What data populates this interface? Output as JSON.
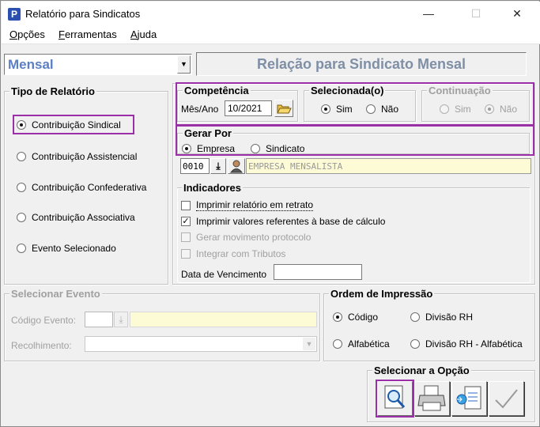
{
  "window": {
    "title": "Relatório para Sindicatos",
    "minimize": "—",
    "maximize": "☐",
    "close": "✕"
  },
  "menu": [
    {
      "key": "O",
      "rest": "pções"
    },
    {
      "key": "F",
      "rest": "erramentas"
    },
    {
      "key": "A",
      "rest": "juda"
    }
  ],
  "period_select": {
    "value": "Mensal",
    "arrow": "▼"
  },
  "report_title": "Relação para Sindicato Mensal",
  "tipo": {
    "title": "Tipo de Relatório",
    "options": [
      "Contribuição Sindical",
      "Contribuição Assistencial",
      "Contribuição Confederativa",
      "Contribuição Associativa",
      "Evento Selecionado"
    ],
    "selected": 0
  },
  "competencia": {
    "title": "Competência",
    "label": "Mês/Ano",
    "value": "10/2021"
  },
  "selecionada": {
    "title": "Selecionada(o)",
    "sim": "Sim",
    "nao": "Não"
  },
  "continuacao": {
    "title": "Continuação",
    "sim": "Sim",
    "nao": "Não"
  },
  "gerar_por": {
    "title": "Gerar Por",
    "empresa": "Empresa",
    "sindicato": "Sindicato"
  },
  "empresa": {
    "code": "0010",
    "name": "EMPRESA MENSALISTA"
  },
  "indicadores": {
    "title": "Indicadores",
    "retrato": "Imprimir relatório em retrato",
    "base_calculo": "Imprimir valores referentes à base de cálculo",
    "protocolo": "Gerar movimento protocolo",
    "tributos": "Integrar com Tributos",
    "vencimento_label": "Data de Vencimento",
    "vencimento_value": ""
  },
  "selecionar_evento": {
    "title": "Selecionar Evento",
    "codigo_label": "Código Evento:",
    "recolhimento_label": "Recolhimento:"
  },
  "ordem": {
    "title": "Ordem de Impressão",
    "codigo": "Código",
    "divisao": "Divisão RH",
    "alfabetica": "Alfabética",
    "divisao_alfa": "Divisão RH - Alfabética"
  },
  "selecionar_opcao": {
    "title": "Selecionar a Opção"
  },
  "colors": {
    "accent_highlight": "#9b2fa8",
    "report_title": "#7f8fa6",
    "select_text": "#5b7fc4",
    "field_yellow": "#fdfbd6"
  }
}
